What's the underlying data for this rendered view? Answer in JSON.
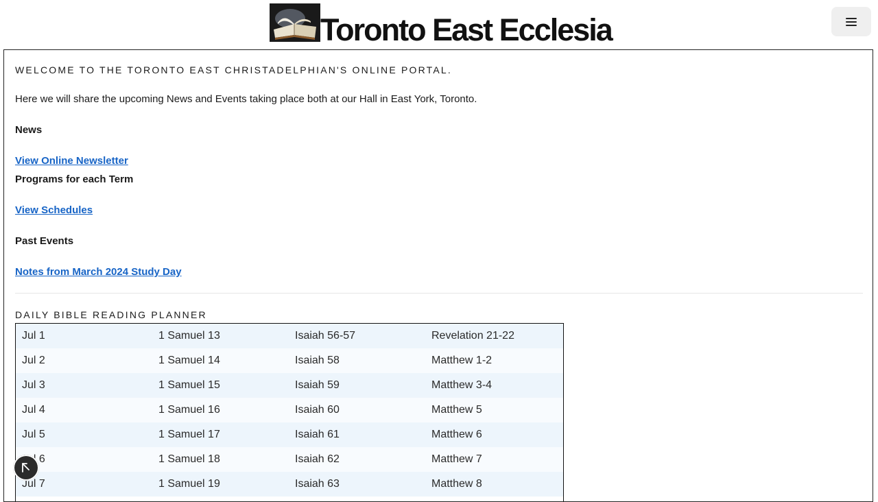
{
  "header": {
    "site_title": "Toronto East Ecclesia",
    "logo_icon": "open-bible-icon",
    "menu_icon": "hamburger-menu-icon"
  },
  "main": {
    "welcome": "WELCOME TO THE TORONTO EAST CHRISTADELPHIAN'S ONLINE PORTAL.",
    "intro": "Here we will share the upcoming News and Events taking place both at our Hall in East York, Toronto.",
    "news_heading": "News",
    "newsletter_link": "View Online Newsletter",
    "programs_heading": "Programs for each Term",
    "schedules_link": "View Schedules",
    "past_events_heading": "Past Events",
    "notes_link": "Notes from March 2024 Study Day"
  },
  "planner": {
    "title": "DAILY BIBLE READING PLANNER",
    "rows": [
      [
        "Jul 1",
        "1 Samuel 13",
        "Isaiah 56-57",
        "Revelation 21-22"
      ],
      [
        "Jul 2",
        "1 Samuel 14",
        "Isaiah 58",
        "Matthew 1-2"
      ],
      [
        "Jul 3",
        "1 Samuel 15",
        "Isaiah 59",
        "Matthew 3-4"
      ],
      [
        "Jul 4",
        "1 Samuel 16",
        "Isaiah 60",
        "Matthew 5"
      ],
      [
        "Jul 5",
        "1 Samuel 17",
        "Isaiah 61",
        "Matthew 6"
      ],
      [
        "Jul 6",
        "1 Samuel 18",
        "Isaiah 62",
        "Matthew 7"
      ],
      [
        "Jul 7",
        "1 Samuel 19",
        "Isaiah 63",
        "Matthew 8"
      ]
    ]
  },
  "colors": {
    "link": "#1764c6",
    "row_odd": "#edf5fc",
    "row_even": "#f8fbfe"
  },
  "fab_icon": "accessibility-cursor-icon"
}
